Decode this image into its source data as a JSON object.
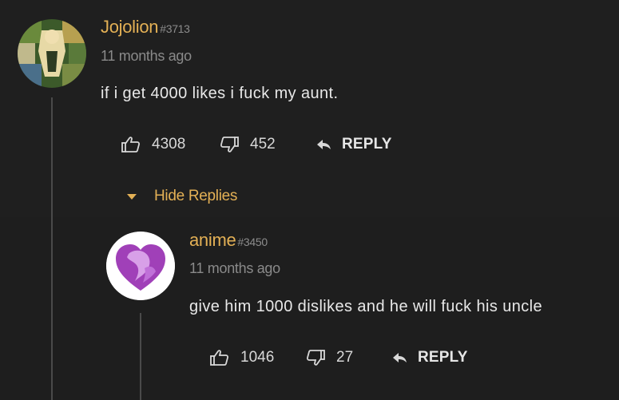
{
  "comment": {
    "username": "Jojolion",
    "user_id": "#3713",
    "time": "11 months ago",
    "text": "if i get 4000 likes i fuck my aunt.",
    "likes": "4308",
    "dislikes": "452",
    "reply_label": "REPLY",
    "hide_replies_label": "Hide Replies"
  },
  "reply": {
    "username": "anime",
    "user_id": "#3450",
    "time": "11 months ago",
    "text": "give him 1000 dislikes and he will fuck his uncle",
    "likes": "1046",
    "dislikes": "27",
    "reply_label": "REPLY"
  },
  "colors": {
    "username": "#e3b055",
    "background": "#1e1e1e",
    "avatar_accent": "#a040b8"
  },
  "icons": [
    "thumbs-up-icon",
    "thumbs-down-icon",
    "reply-arrow-icon",
    "caret-down-icon"
  ]
}
